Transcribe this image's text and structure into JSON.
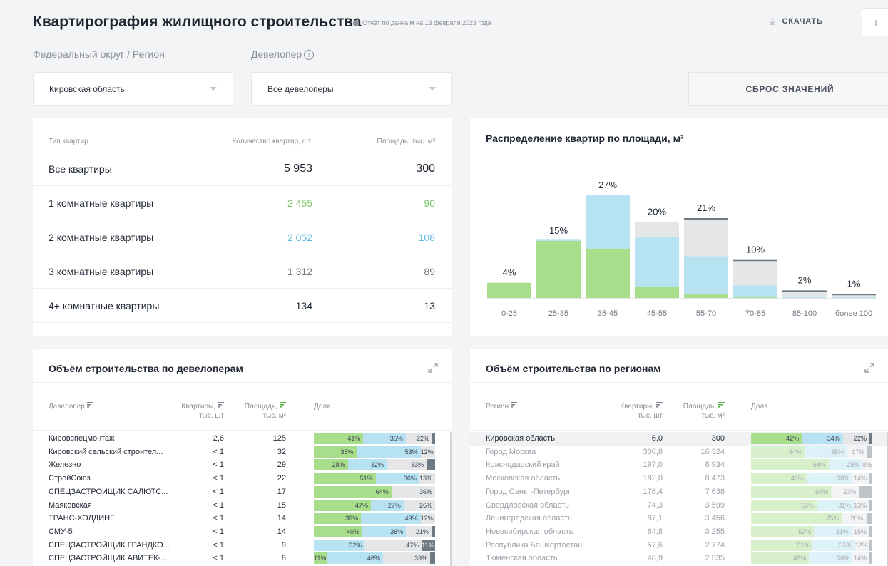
{
  "header": {
    "title": "Квартирография жилищного строительства",
    "report_note": "Отчёт по данным на 13 февраля 2023 года",
    "download_label": "СКАЧАТЬ",
    "info_label": "i"
  },
  "filters": {
    "region_label": "Федеральный округ / Регион",
    "developer_label": "Девелопер",
    "region_value": "Кировская область",
    "developer_value": "Все девелоперы",
    "reset_label": "СБРОС ЗНАЧЕНИЙ"
  },
  "apartment_types": {
    "headers": {
      "type": "Тип квартир",
      "count": "Количество квартир, шт.",
      "area": "Площадь, тыс. м²"
    },
    "rows": [
      {
        "name": "Все квартиры",
        "count": "5 953",
        "area": "300",
        "color": "#1f2733"
      },
      {
        "name": "1 комнатные квартиры",
        "count": "2 455",
        "area": "90",
        "color": "#7cc56a"
      },
      {
        "name": "2 комнатные квартиры",
        "count": "2 052",
        "area": "108",
        "color": "#5eb8dc"
      },
      {
        "name": "3 комнатные квартиры",
        "count": "1 312",
        "area": "89",
        "color": "#6f7780"
      },
      {
        "name": "4+ комнатные квартиры",
        "count": "134",
        "area": "13",
        "color": "#1f2733"
      }
    ]
  },
  "area_distribution": {
    "title": "Распределение квартир по площади, м²"
  },
  "chart_data": {
    "type": "bar",
    "stacked": true,
    "categories": [
      "0-25",
      "25-35",
      "35-45",
      "45-55",
      "55-70",
      "70-85",
      "85-100",
      "более 100"
    ],
    "totals_label": [
      "4%",
      "15%",
      "27%",
      "20%",
      "21%",
      "10%",
      "2%",
      "1%"
    ],
    "totals": [
      4,
      15,
      27,
      20,
      21,
      10,
      2,
      1
    ],
    "series": [
      {
        "values": [
          4,
          15,
          13,
          3,
          1,
          0.3,
          0,
          0
        ],
        "color": "#a8dd8c"
      },
      {
        "values": [
          0,
          0.5,
          14,
          13,
          10,
          3,
          0.4,
          0.3
        ],
        "color": "#b6e2f1"
      },
      {
        "values": [
          0,
          0,
          0,
          4,
          9.5,
          6.4,
          1.2,
          0.4
        ],
        "color": "#e4e6e8"
      },
      {
        "values": [
          0,
          0,
          0,
          0,
          0.5,
          0.3,
          0.4,
          0.3
        ],
        "color": "#6e7b85"
      }
    ],
    "ylim": [
      0,
      30
    ]
  },
  "developers": {
    "title": "Объём строительства по девелоперам",
    "headers": {
      "name": "Девелопер",
      "apts_1": "Квартиры,",
      "apts_2": "тыс. шт",
      "area_1": "Площадь,",
      "area_2": "тыс. м²",
      "share": "Доля"
    },
    "rows": [
      {
        "name": "Кировспецмонтаж",
        "apts": "2,6",
        "area": "125",
        "share": [
          41,
          35,
          22,
          2
        ],
        "labels": [
          "41%",
          "35%",
          "22%",
          ""
        ]
      },
      {
        "name": "Кировский сельский строител...",
        "apts": "< 1",
        "area": "32",
        "share": [
          35,
          53,
          12,
          0
        ],
        "labels": [
          "35%",
          "53%",
          "12%",
          ""
        ]
      },
      {
        "name": "Железно",
        "apts": "< 1",
        "area": "29",
        "share": [
          28,
          32,
          33,
          7
        ],
        "labels": [
          "28%",
          "32%",
          "33%",
          ""
        ]
      },
      {
        "name": "СтройСоюз",
        "apts": "< 1",
        "area": "22",
        "share": [
          51,
          36,
          13,
          0
        ],
        "labels": [
          "51%",
          "36%",
          "13%",
          ""
        ]
      },
      {
        "name": "СПЕЦЗАСТРОЙЩИК САЛЮТС...",
        "apts": "< 1",
        "area": "17",
        "share": [
          64,
          0,
          36,
          0
        ],
        "labels": [
          "64%",
          "",
          "36%",
          ""
        ]
      },
      {
        "name": "Маяковская",
        "apts": "< 1",
        "area": "15",
        "share": [
          47,
          27,
          26,
          0
        ],
        "labels": [
          "47%",
          "27%",
          "26%",
          ""
        ]
      },
      {
        "name": "ТРАНС-ХОЛДИНГ",
        "apts": "< 1",
        "area": "14",
        "share": [
          39,
          49,
          12,
          0
        ],
        "labels": [
          "39%",
          "49%",
          "12%",
          ""
        ]
      },
      {
        "name": "СМУ-5",
        "apts": "< 1",
        "area": "14",
        "share": [
          40,
          36,
          21,
          3
        ],
        "labels": [
          "40%",
          "36%",
          "21%",
          ""
        ]
      },
      {
        "name": "СПЕЦЗАСТРОЙЩИК ГРАНДКО...",
        "apts": "< 1",
        "area": "9",
        "share": [
          0,
          42,
          47,
          11
        ],
        "labels": [
          "",
          "32%",
          "47%",
          "11%"
        ]
      },
      {
        "name": "СПЕЦЗАСТРОЙЩИК АВИТЕК-...",
        "apts": "< 1",
        "area": "8",
        "share": [
          11,
          46,
          39,
          4
        ],
        "labels": [
          "11%",
          "46%",
          "39%",
          ""
        ]
      }
    ]
  },
  "regions": {
    "title": "Объём строительства по регионам",
    "headers": {
      "name": "Регион",
      "apts_1": "Квартиры,",
      "apts_2": "тыс. шт",
      "area_1": "Площадь,",
      "area_2": "тыс. м²",
      "share": "Доля"
    },
    "rows": [
      {
        "name": "Кировская область",
        "apts": "6,0",
        "area": "300",
        "share": [
          42,
          34,
          22,
          2
        ],
        "labels": [
          "42%",
          "34%",
          "22%",
          ""
        ]
      },
      {
        "name": "Город Москва",
        "apts": "306,8",
        "area": "16 324",
        "share": [
          44,
          35,
          17,
          4
        ],
        "labels": [
          "44%",
          "35%",
          "17%",
          ""
        ]
      },
      {
        "name": "Краснодарский край",
        "apts": "197,0",
        "area": "8 934",
        "share": [
          64,
          28,
          8,
          0
        ],
        "labels": [
          "64%",
          "28%",
          "8%",
          ""
        ]
      },
      {
        "name": "Московская область",
        "apts": "182,0",
        "area": "8 473",
        "share": [
          46,
          38,
          14,
          2
        ],
        "labels": [
          "46%",
          "38%",
          "14%",
          ""
        ]
      },
      {
        "name": "Город Санкт-Петербург",
        "apts": "176,4",
        "area": "7 638",
        "share": [
          66,
          0,
          23,
          11
        ],
        "labels": [
          "66%",
          "",
          "23%",
          ""
        ]
      },
      {
        "name": "Свердловская область",
        "apts": "74,3",
        "area": "3 599",
        "share": [
          55,
          31,
          13,
          1
        ],
        "labels": [
          "55%",
          "31%",
          "13%",
          ""
        ]
      },
      {
        "name": "Ленинградская область",
        "apts": "87,1",
        "area": "3 456",
        "share": [
          75,
          0,
          20,
          5
        ],
        "labels": [
          "75%",
          "",
          "20%",
          ""
        ]
      },
      {
        "name": "Новосибирская область",
        "apts": "64,8",
        "area": "3 255",
        "share": [
          52,
          31,
          15,
          2
        ],
        "labels": [
          "52%",
          "31%",
          "15%",
          ""
        ]
      },
      {
        "name": "Республика Башкортостан",
        "apts": "57,6",
        "area": "2 774",
        "share": [
          51,
          35,
          12,
          2
        ],
        "labels": [
          "51%",
          "35%",
          "12%",
          ""
        ]
      },
      {
        "name": "Тюменская область",
        "apts": "48,9",
        "area": "2 535",
        "share": [
          48,
          36,
          14,
          2
        ],
        "labels": [
          "48%",
          "36%",
          "14%",
          ""
        ]
      }
    ]
  }
}
